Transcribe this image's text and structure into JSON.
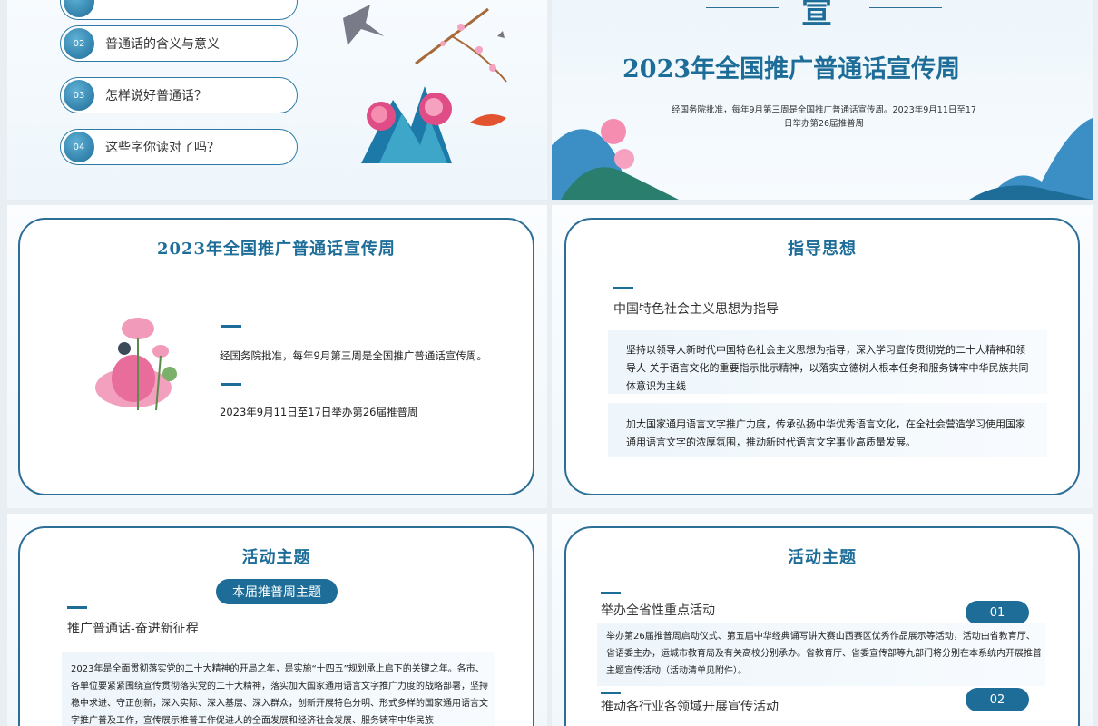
{
  "agenda": [
    {
      "num": "02",
      "label": "普通话的含义与意义"
    },
    {
      "num": "03",
      "label": "怎样说好普通话？"
    },
    {
      "num": "04",
      "label": "这些字你读对了吗？"
    }
  ],
  "cover": {
    "char_top": "宣",
    "title": "2023年全国推广普通话宣传周",
    "desc": "经国务院批准，每年9月第三周是全国推广普通话宣传周。2023年9月11日至17日举办第26届推普周"
  },
  "week": {
    "title": "2023年全国推广普通话宣传周",
    "line1": "经国务院批准，每年9月第三周是全国推广普通话宣传周。",
    "line2": "2023年9月11日至17日举办第26届推普周"
  },
  "guide": {
    "title": "指导思想",
    "subtitle": "中国特色社会主义思想为指导",
    "para1": "坚持以领导人新时代中国特色社会主义思想为指导，深入学习宣传贯彻党的二十大精神和领导人 关于语言文化的重要指示批示精神，以落实立德树人根本任务和服务铸牢中华民族共同体意识为主线",
    "para2": "加大国家通用语言文字推广力度，传承弘扬中华优秀语言文化，在全社会营造学习使用国家通用语言文字的浓厚氛围，推动新时代语言文字事业高质量发展。"
  },
  "theme1": {
    "title": "活动主题",
    "badge": "本届推普周主题",
    "subtitle": "推广普通话-奋进新征程",
    "para": "2023年是全面贯彻落实党的二十大精神的开局之年，是实施“十四五”规划承上启下的关键之年。各市、各单位要紧紧围绕宣传贯彻落实党的二十大精神，落实加大国家通用语言文字推广力度的战略部署，坚持稳中求进、守正创新，深入实际、深入基层、深入群众，创新开展特色分明、形式多样的国家通用语言文字推广普及工作，宣传展示推普工作促进人的全面发展和经济社会发展、服务铸牢中华民族"
  },
  "theme2": {
    "title": "活动主题",
    "item1_title": "举办全省性重点活动",
    "item1_num": "01",
    "item1_text": "举办第26届推普周启动仪式、第五届中华经典诵写讲大赛山西赛区优秀作品展示等活动，活动由省教育厅、省语委主办，运城市教育局及有关高校分别承办。省教育厅、省委宣传部等九部门将分别在本系统内开展推普主题宣传活动（活动清单见附件）。",
    "item2_title": "推动各行业各领域开展宣传活动",
    "item2_num": "02"
  },
  "colors": {
    "accent": "#1d6d98",
    "border": "#2d6e97"
  }
}
